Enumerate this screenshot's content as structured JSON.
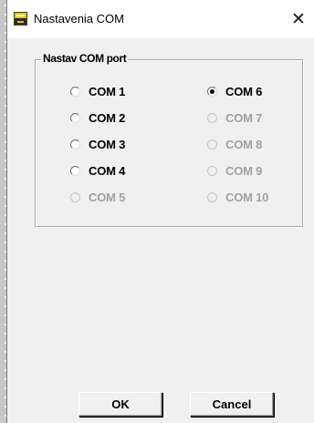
{
  "window": {
    "title": "Nastavenia COM",
    "close_glyph": "✕",
    "icon": "app-icon"
  },
  "group": {
    "title": "Nastav COM port"
  },
  "ports_left": [
    {
      "label": "COM 1",
      "enabled": true,
      "selected": false
    },
    {
      "label": "COM 2",
      "enabled": true,
      "selected": false
    },
    {
      "label": "COM 3",
      "enabled": true,
      "selected": false
    },
    {
      "label": "COM 4",
      "enabled": true,
      "selected": false
    },
    {
      "label": "COM 5",
      "enabled": false,
      "selected": false
    }
  ],
  "ports_right": [
    {
      "label": "COM 6",
      "enabled": true,
      "selected": true
    },
    {
      "label": "COM 7",
      "enabled": false,
      "selected": false
    },
    {
      "label": "COM 8",
      "enabled": false,
      "selected": false
    },
    {
      "label": "COM 9",
      "enabled": false,
      "selected": false
    },
    {
      "label": "COM 10",
      "enabled": false,
      "selected": false
    }
  ],
  "buttons": {
    "ok_label": "OK",
    "cancel_label": "Cancel"
  },
  "colors": {
    "disabled_text": "#a0a0a0",
    "dialog_bg": "#f0f0f0",
    "icon_accent": "#e8c000"
  }
}
